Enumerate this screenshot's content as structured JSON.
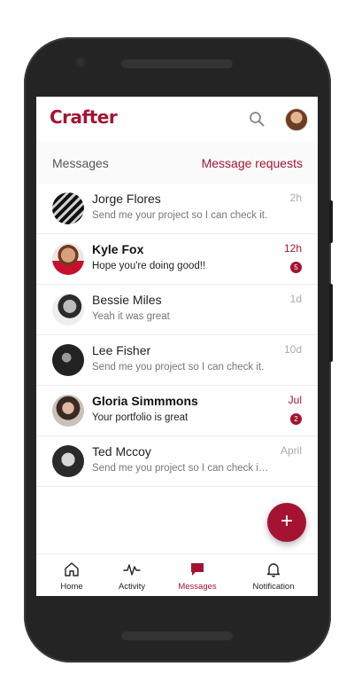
{
  "app": {
    "logo": "Crafter",
    "brand_color": "#a41432"
  },
  "header": {
    "search_icon": "search-icon",
    "avatar": "user-avatar"
  },
  "subheader": {
    "title": "Messages",
    "requests_label": "Message requests"
  },
  "conversations": [
    {
      "name": "Jorge Flores",
      "preview": "Send me your project so I can check it.",
      "time": "2h",
      "unread": false,
      "badge": ""
    },
    {
      "name": "Kyle Fox",
      "preview": "Hope you're doing good!!",
      "time": "12h",
      "unread": true,
      "badge": "5"
    },
    {
      "name": "Bessie Miles",
      "preview": "Yeah it was great",
      "time": "1d",
      "unread": false,
      "badge": ""
    },
    {
      "name": "Lee Fisher",
      "preview": "Send me you project so I can check it.",
      "time": "10d",
      "unread": false,
      "badge": ""
    },
    {
      "name": "Gloria Simmmons",
      "preview": "Your portfolio is great",
      "time": "Jul",
      "unread": true,
      "badge": "2"
    },
    {
      "name": "Ted Mccoy",
      "preview": "Send me you project so I can check it...",
      "time": "April",
      "unread": false,
      "badge": ""
    }
  ],
  "fab": {
    "label": "+",
    "icon": "plus-icon"
  },
  "nav": [
    {
      "label": "Home",
      "icon": "home-icon",
      "active": false
    },
    {
      "label": "Activity",
      "icon": "activity-icon",
      "active": false
    },
    {
      "label": "Messages",
      "icon": "message-icon",
      "active": true
    },
    {
      "label": "Notification",
      "icon": "bell-icon",
      "active": false
    }
  ]
}
